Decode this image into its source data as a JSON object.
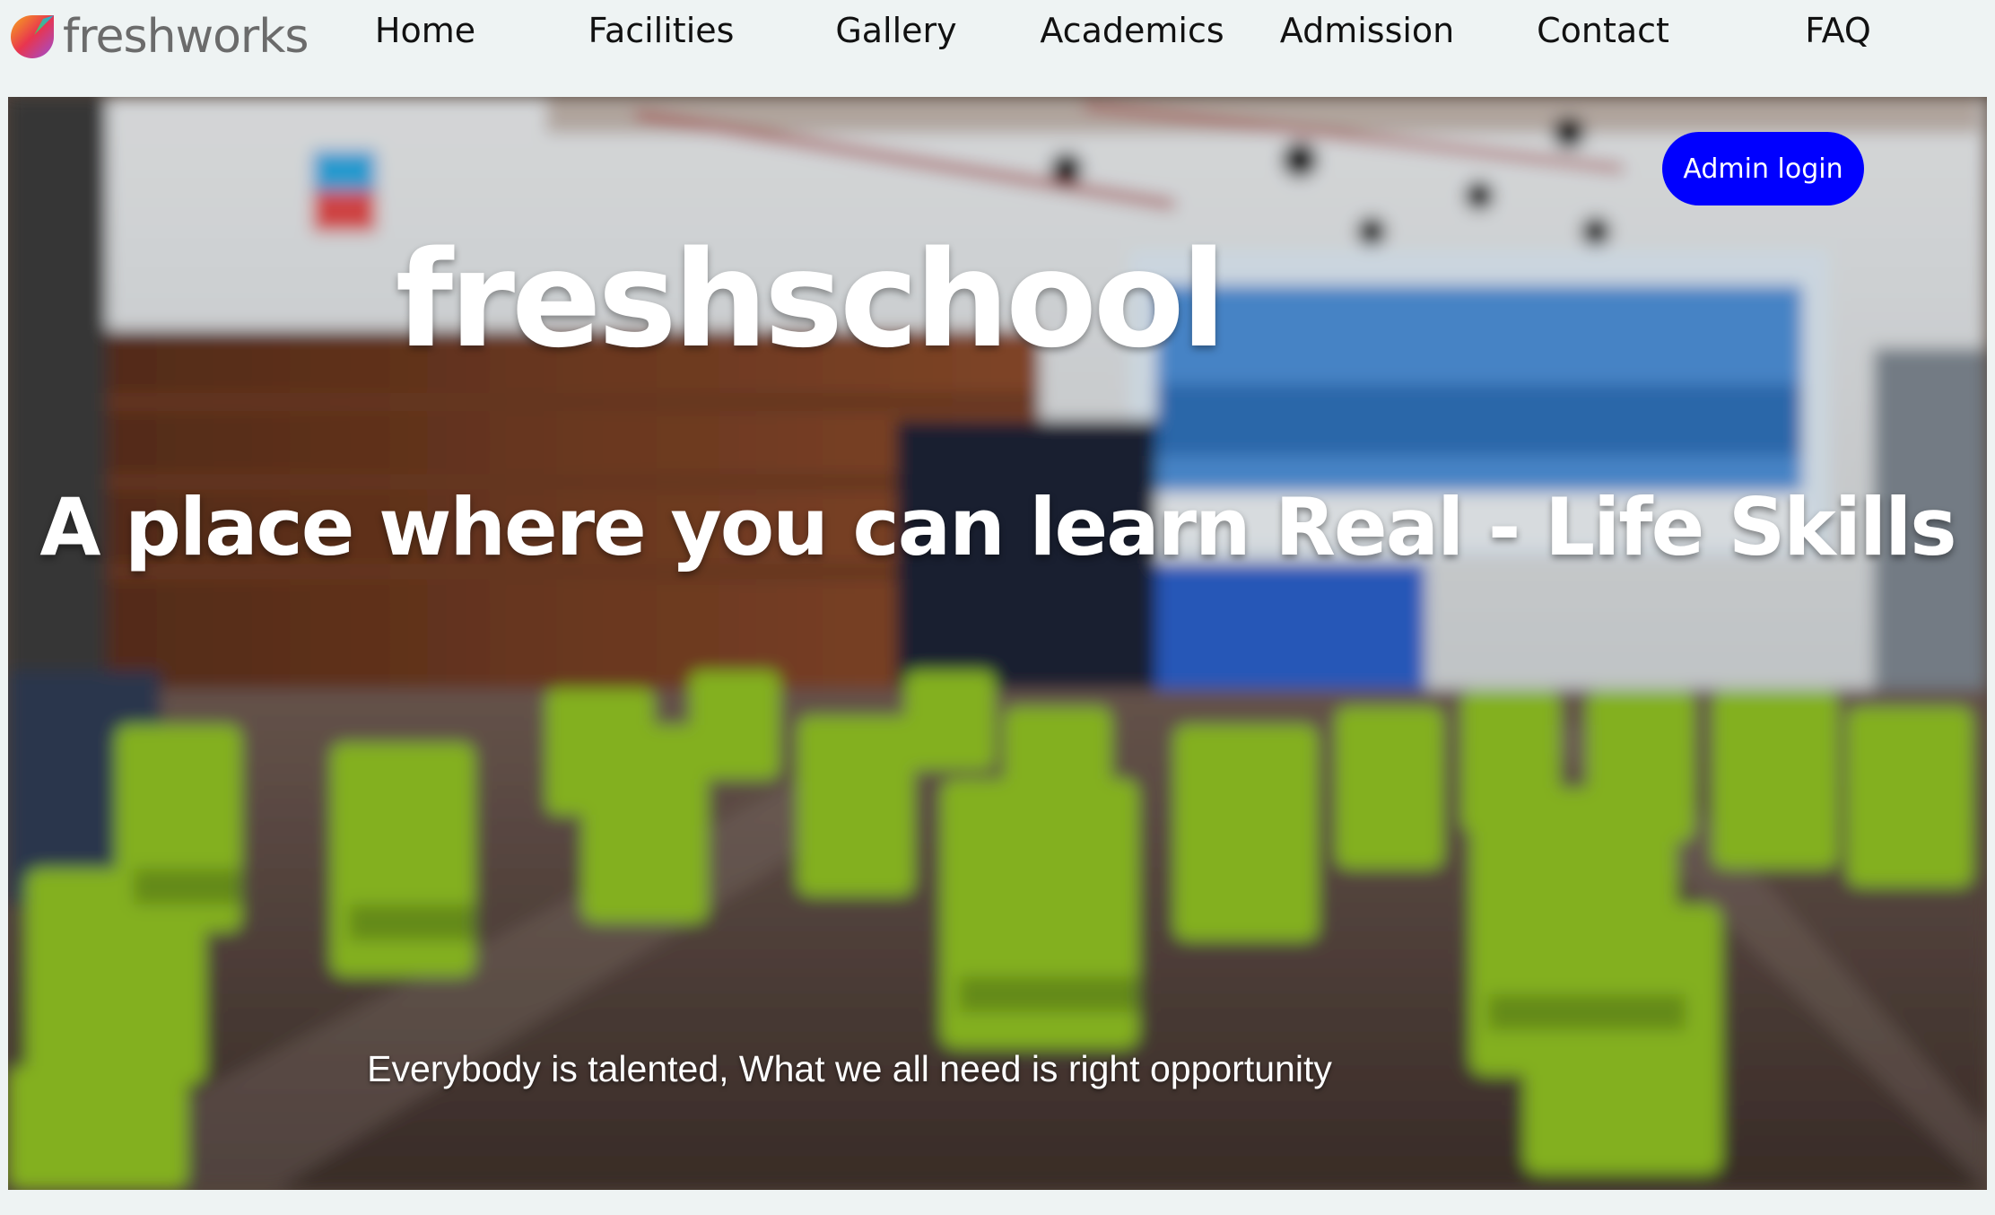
{
  "brand": {
    "name": "freshworks",
    "icon": "freshworks-logo-icon",
    "colors": [
      "#f7a81b",
      "#e8354f",
      "#2aa7e0",
      "#5cc24a",
      "#9c4fd6"
    ]
  },
  "nav": {
    "items": [
      {
        "label": "Home"
      },
      {
        "label": "Facilities"
      },
      {
        "label": "Gallery"
      },
      {
        "label": "Academics"
      },
      {
        "label": "Admission"
      },
      {
        "label": "Contact"
      },
      {
        "label": "FAQ"
      }
    ]
  },
  "hero": {
    "admin_button": "Admin login",
    "admin_button_color": "#0000ff",
    "title": "freshschool",
    "tagline": "A place where you can learn Real - Life Skills",
    "subtitle": "Everybody is talented, What we all need is right opportunity",
    "background": "blurred-auditorium-with-green-chairs"
  }
}
